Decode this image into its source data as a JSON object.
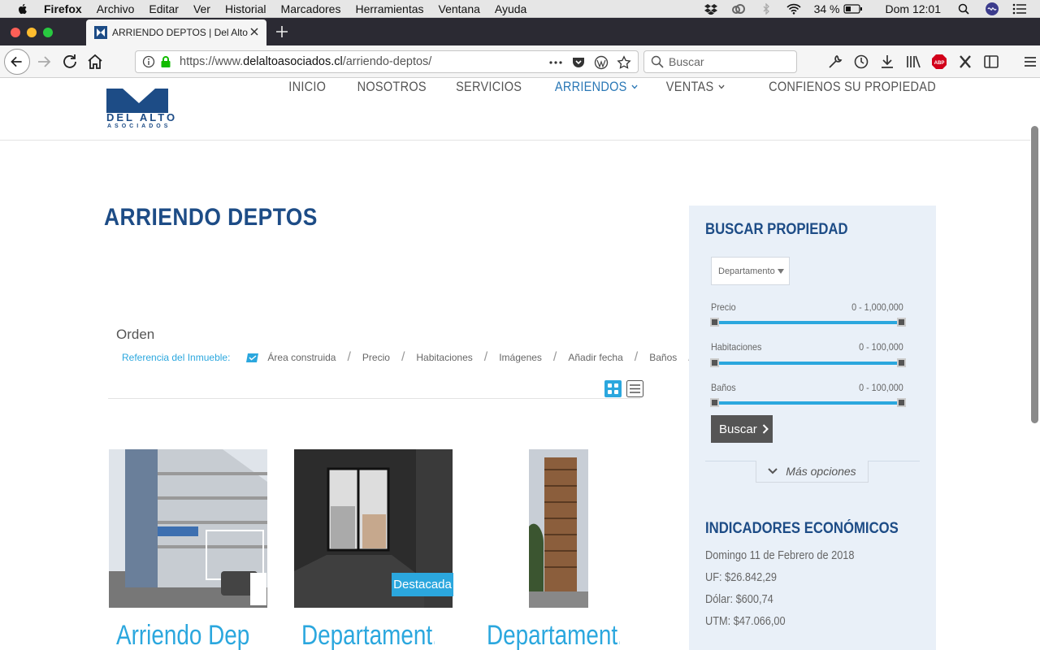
{
  "menubar": {
    "app": "Firefox",
    "items": [
      "Archivo",
      "Editar",
      "Ver",
      "Historial",
      "Marcadores",
      "Herramientas",
      "Ventana",
      "Ayuda"
    ],
    "battery": "34 %",
    "clock": "Dom 12:01"
  },
  "tab": {
    "title": "ARRIENDO DEPTOS | Del Alto Asociados"
  },
  "navbar": {
    "url_prefix": "https://www.",
    "url_domain": "delaltoasociados.cl",
    "url_path": "/arriendo-deptos/",
    "search_placeholder": "Buscar"
  },
  "site": {
    "logo_text": "DEL ALTO",
    "logo_sub": "ASOCIADOS",
    "nav": [
      {
        "label": "INICIO",
        "active": false
      },
      {
        "label": "NOSOTROS",
        "active": false
      },
      {
        "label": "SERVICIOS",
        "active": false
      },
      {
        "label": "ARRIENDOS",
        "active": true
      },
      {
        "label": "VENTAS",
        "active": false
      },
      {
        "label": "CONFIENOS SU PROPIEDAD",
        "active": false
      }
    ]
  },
  "content": {
    "page_title": "ARRIENDO DEPTOS",
    "orden_label": "Orden",
    "sort_reference": "Referencia del Inmueble:",
    "sort_items": [
      "Área construida",
      "Precio",
      "Habitaciones",
      "Imágenes",
      "Añadir fecha",
      "Baños"
    ],
    "badge": "Destacada",
    "cards": [
      {
        "title": "Arriendo Dep..."
      },
      {
        "title": "Departament..."
      },
      {
        "title": "Departament..."
      }
    ]
  },
  "sidebar": {
    "search_title": "BUSCAR PROPIEDAD",
    "type_select": "Departamento",
    "ranges": [
      {
        "label": "Precio",
        "value": "0 - 1,000,000"
      },
      {
        "label": "Habitaciones",
        "value": "0 - 100,000"
      },
      {
        "label": "Baños",
        "value": "0 - 100,000"
      }
    ],
    "search_button": "Buscar",
    "more_options": "Más opciones",
    "indicators_title": "INDICADORES ECONÓMICOS",
    "indicators": [
      "Domingo 11 de Febrero de 2018",
      "UF: $26.842,29",
      "Dólar: $600,74",
      "UTM: $47.066,00"
    ]
  },
  "colors": {
    "brand_blue": "#1d4c86",
    "accent_cyan": "#2ba7de",
    "sidebar_bg": "#e9f0f8"
  }
}
